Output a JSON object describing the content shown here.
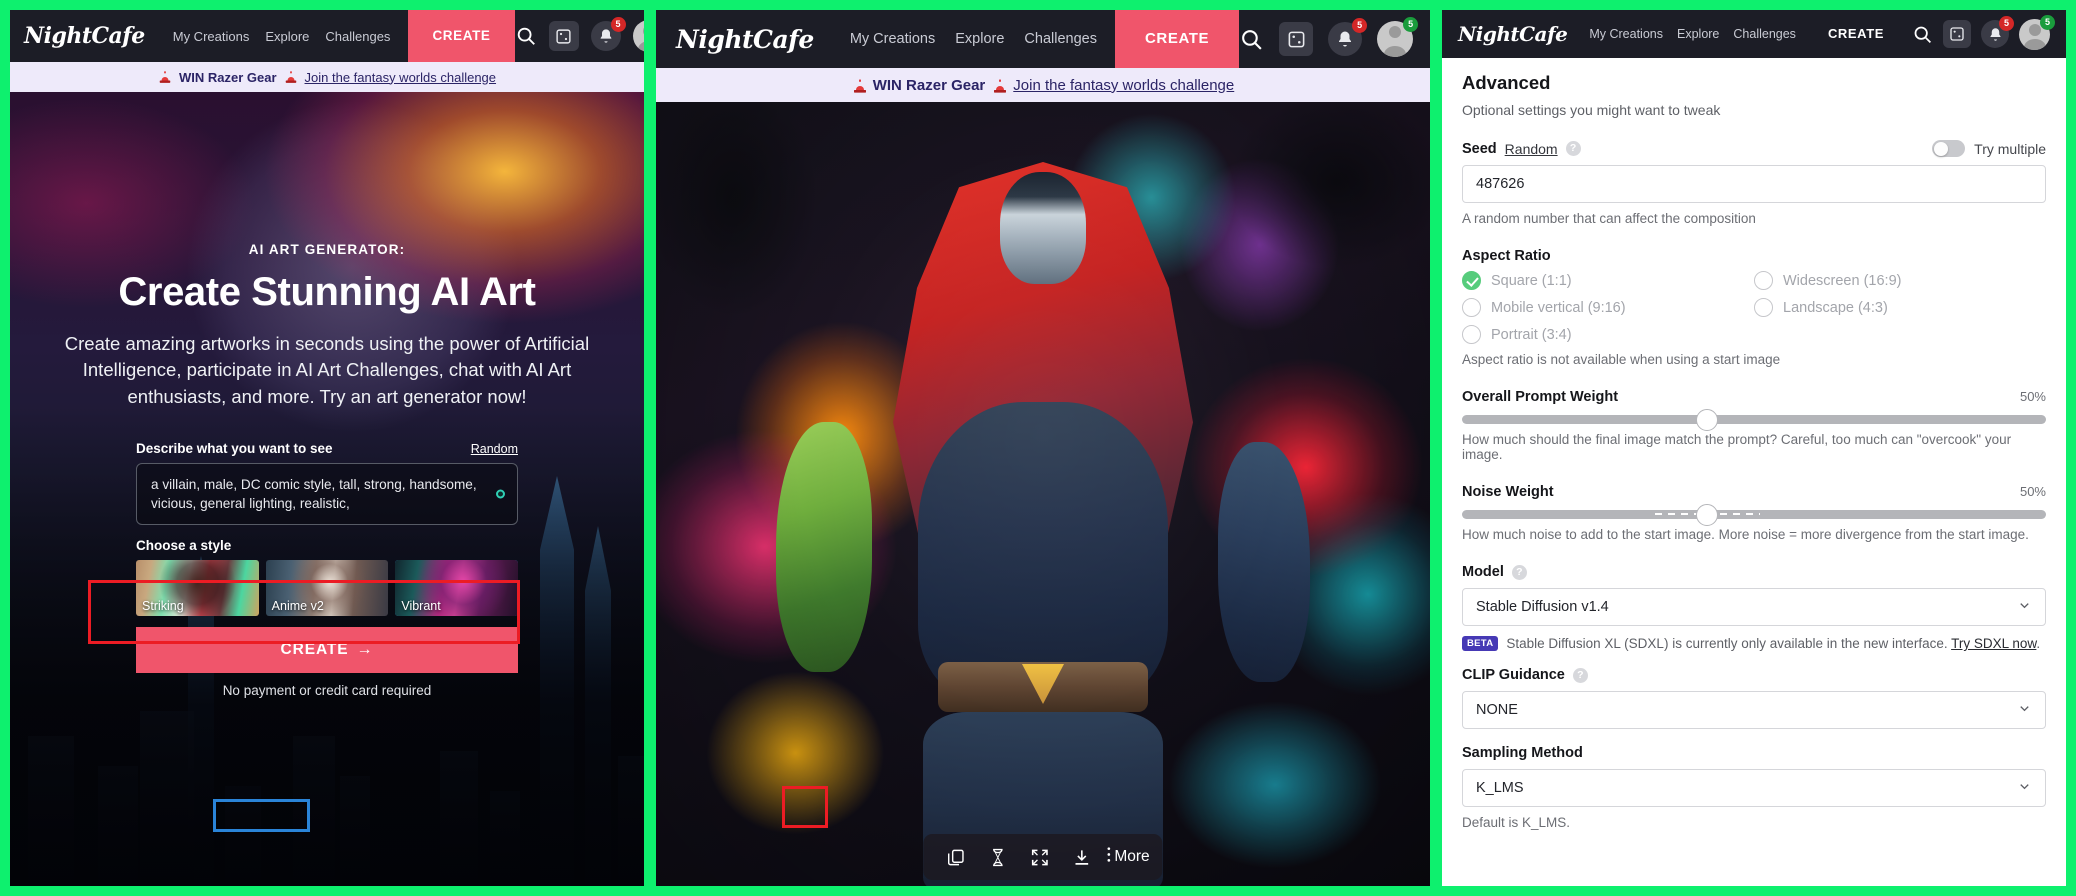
{
  "nav": {
    "brand": "NightCafe",
    "links": [
      "My Creations",
      "Explore",
      "Challenges"
    ],
    "create_label": "CREATE",
    "search_icon": "search-icon",
    "dice_icon": "dice-icon",
    "bell_icon": "bell-icon",
    "bell_badge": "5",
    "avatar_badge": "5"
  },
  "promo": {
    "text": "WIN Razer Gear",
    "link": "Join the fantasy worlds challenge"
  },
  "hero": {
    "eyebrow": "AI ART GENERATOR:",
    "title": "Create Stunning AI Art",
    "paragraph": "Create amazing artworks in seconds using the power of Artificial Intelligence, participate in AI Art Challenges, chat with AI Art enthusiasts, and more. Try an art generator now!"
  },
  "form": {
    "label": "Describe what you want to see",
    "random_label": "Random",
    "prompt_value": "a villain, male, DC comic style, tall, strong, handsome, vicious, general lighting, realistic,",
    "choose_style_label": "Choose a style",
    "styles": [
      {
        "name": "Striking",
        "selected": false
      },
      {
        "name": "Anime v2",
        "selected": false
      },
      {
        "name": "Vibrant",
        "selected": true
      }
    ],
    "create_label": "CREATE",
    "create_arrow": "→",
    "footnote": "No payment or credit card required"
  },
  "artwork": {
    "toolbar": {
      "copy_icon": "copy-icon",
      "hourglass_icon": "hourglass-icon",
      "fullscreen_icon": "fullscreen-icon",
      "download_icon": "download-icon",
      "kebab_icon": "kebab-menu-icon",
      "more_label": "More"
    }
  },
  "advanced": {
    "title": "Advanced",
    "subtitle": "Optional settings you might want to tweak",
    "seed": {
      "label": "Seed",
      "random_link": "Random",
      "toggle_label": "Try multiple",
      "value": "487626",
      "hint": "A random number that can affect the composition"
    },
    "aspect_ratio": {
      "label": "Aspect Ratio",
      "options": [
        {
          "label": "Square (1:1)",
          "selected": true
        },
        {
          "label": "Widescreen (16:9)",
          "selected": false
        },
        {
          "label": "Mobile vertical (9:16)",
          "selected": false
        },
        {
          "label": "Landscape (4:3)",
          "selected": false
        },
        {
          "label": "Portrait (3:4)",
          "selected": false
        }
      ],
      "hint": "Aspect ratio is not available when using a start image"
    },
    "prompt_weight": {
      "label": "Overall Prompt Weight",
      "percent": "50%",
      "hint": "How much should the final image match the prompt? Careful, too much can \"overcook\" your image."
    },
    "noise_weight": {
      "label": "Noise Weight",
      "percent": "50%",
      "hint": "How much noise to add to the start image. More noise = more divergence from the start image."
    },
    "model": {
      "label": "Model",
      "value": "Stable Diffusion v1.4",
      "beta_badge": "BETA",
      "beta_text": "Stable Diffusion XL (SDXL) is currently only available in the new interface.",
      "beta_link": "Try SDXL now",
      "beta_tail": "."
    },
    "clip_guidance": {
      "label": "CLIP Guidance",
      "value": "NONE"
    },
    "sampling_method": {
      "label": "Sampling Method",
      "value": "K_LMS",
      "hint": "Default is K_LMS."
    }
  },
  "colors": {
    "accent_pink": "#f0556b",
    "divider_green": "#0ef06e",
    "annotation_red": "#ec1c24",
    "annotation_blue": "#2a84d8",
    "check_green": "#56cc7c",
    "beta_purple": "#4639b5"
  }
}
